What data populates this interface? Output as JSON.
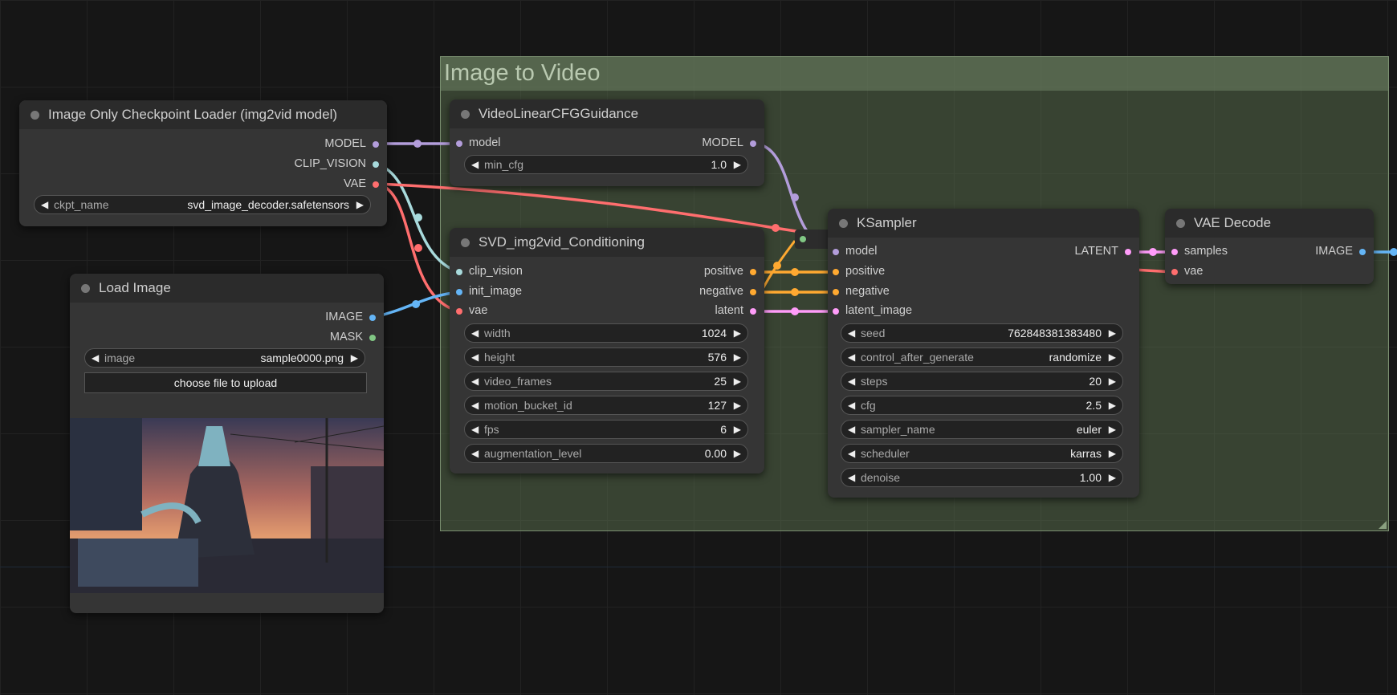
{
  "colors": {
    "model": "#b39ddb",
    "clip_vision": "#a8dadc",
    "vae": "#ff6e6e",
    "image": "#64b5f6",
    "mask": "#81c784",
    "conditioning": "#ffa931",
    "latent": "#ff9cf9"
  },
  "group": {
    "title": "Image to Video"
  },
  "checkpoint_loader": {
    "title": "Image Only Checkpoint Loader (img2vid model)",
    "outputs": [
      "MODEL",
      "CLIP_VISION",
      "VAE"
    ],
    "ckpt_label": "ckpt_name",
    "ckpt_value": "svd_image_decoder.safetensors"
  },
  "load_image": {
    "title": "Load Image",
    "outputs": [
      "IMAGE",
      "MASK"
    ],
    "image_label": "image",
    "image_value": "sample0000.png",
    "upload_label": "choose file to upload",
    "preview_icon": "anime-girl-sunset-preview"
  },
  "cfg_guidance": {
    "title": "VideoLinearCFGGuidance",
    "input": "model",
    "output": "MODEL",
    "min_cfg_label": "min_cfg",
    "min_cfg_value": "1.0"
  },
  "svd_cond": {
    "title": "SVD_img2vid_Conditioning",
    "inputs": [
      "clip_vision",
      "init_image",
      "vae"
    ],
    "outputs": [
      "positive",
      "negative",
      "latent"
    ],
    "widgets": [
      {
        "label": "width",
        "value": "1024"
      },
      {
        "label": "height",
        "value": "576"
      },
      {
        "label": "video_frames",
        "value": "25"
      },
      {
        "label": "motion_bucket_id",
        "value": "127"
      },
      {
        "label": "fps",
        "value": "6"
      },
      {
        "label": "augmentation_level",
        "value": "0.00"
      }
    ]
  },
  "ksampler": {
    "title": "KSampler",
    "inputs": [
      "model",
      "positive",
      "negative",
      "latent_image"
    ],
    "output": "LATENT",
    "widgets": [
      {
        "label": "seed",
        "value": "762848381383480"
      },
      {
        "label": "control_after_generate",
        "value": "randomize"
      },
      {
        "label": "steps",
        "value": "20"
      },
      {
        "label": "cfg",
        "value": "2.5"
      },
      {
        "label": "sampler_name",
        "value": "euler"
      },
      {
        "label": "scheduler",
        "value": "karras"
      },
      {
        "label": "denoise",
        "value": "1.00"
      }
    ]
  },
  "vae_decode": {
    "title": "VAE Decode",
    "inputs": [
      "samples",
      "vae"
    ],
    "output": "IMAGE"
  }
}
